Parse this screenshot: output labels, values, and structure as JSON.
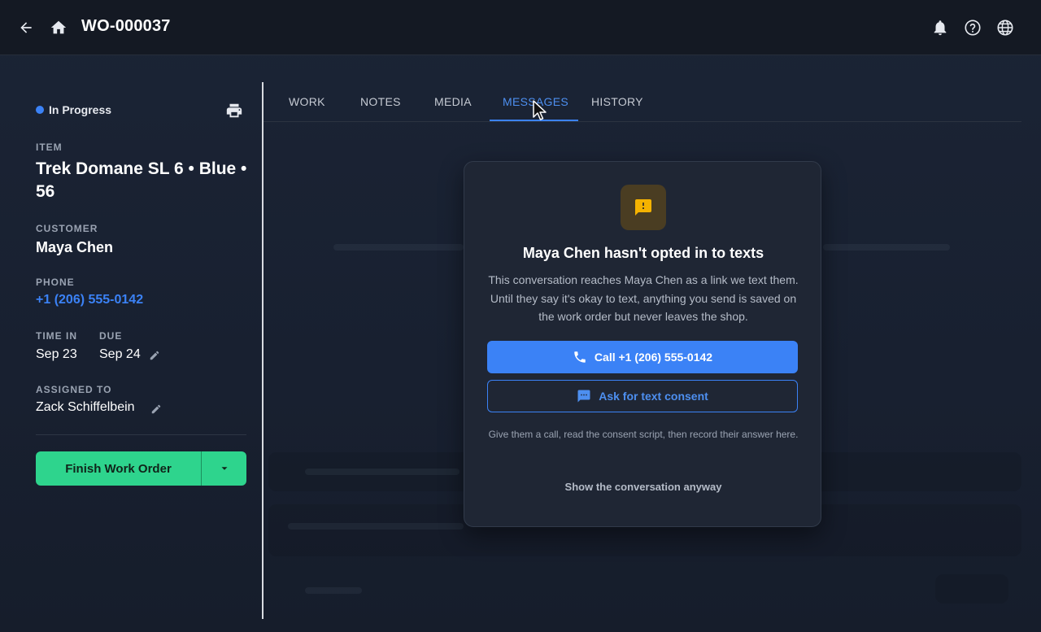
{
  "header": {
    "title": "WO-000037",
    "back_icon": "arrow-left-icon",
    "home_icon": "home-icon",
    "notifications_icon": "bell-icon",
    "help_icon": "help-circle-icon",
    "language_icon": "globe-icon"
  },
  "work_order": {
    "status": "In Progress",
    "status_color": "#3b82f6",
    "item_label": "ITEM",
    "item_value": "Trek Domane SL 6 • Blue • 56",
    "customer_label": "CUSTOMER",
    "customer_value": "Maya Chen",
    "phone_label": "PHONE",
    "phone_value": "+1 (206) 555-0142",
    "time_in_label": "TIME IN",
    "time_in_value": "Sep 23",
    "due_label": "DUE",
    "due_value": "Sep 24",
    "assigned_label": "ASSIGNED TO",
    "assigned_value": "Zack Schiffelbein",
    "finish_label": "Finish Work Order",
    "finish_color": "#2ed48d"
  },
  "tabs": [
    {
      "label": "WORK",
      "active": false
    },
    {
      "label": "NOTES",
      "active": false
    },
    {
      "label": "MEDIA",
      "active": false
    },
    {
      "label": "MESSAGES",
      "active": true
    },
    {
      "label": "HISTORY",
      "active": false
    }
  ],
  "modal": {
    "icon": "message-alert-icon",
    "title": "Maya Chen hasn't opted in to texts",
    "body": "This conversation reaches Maya Chen as a link we text them. Until they say it's okay to text, anything you send is saved on the work order but never leaves the shop.",
    "call_label": "Call +1 (206) 555-0142",
    "consent_label": "Ask for text consent",
    "hint": "Give them a call, read the consent script, then record their answer here.",
    "show_anyway": "Show the conversation anyway",
    "accent": "#3b82f6"
  }
}
